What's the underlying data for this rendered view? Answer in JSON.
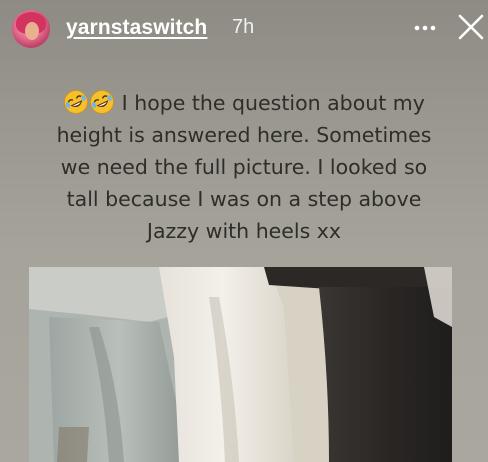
{
  "header": {
    "username": "yarnstaswitch",
    "timestamp": "7h",
    "more_icon": "more-options-icon",
    "close_icon": "close-icon"
  },
  "caption": {
    "emojis": [
      "rolling-on-floor-laughing-emoji",
      "rolling-on-floor-laughing-emoji"
    ],
    "lines": [
      "I hope the question about my",
      "height is answered here. Sometimes",
      "we need the full picture. I looked so",
      "tall because I was on a step above",
      "Jazzy with heels xx"
    ]
  },
  "colors": {
    "background": "#a5a39a",
    "caption_text": "#2f2d2a",
    "header_text": "#ffffff"
  }
}
